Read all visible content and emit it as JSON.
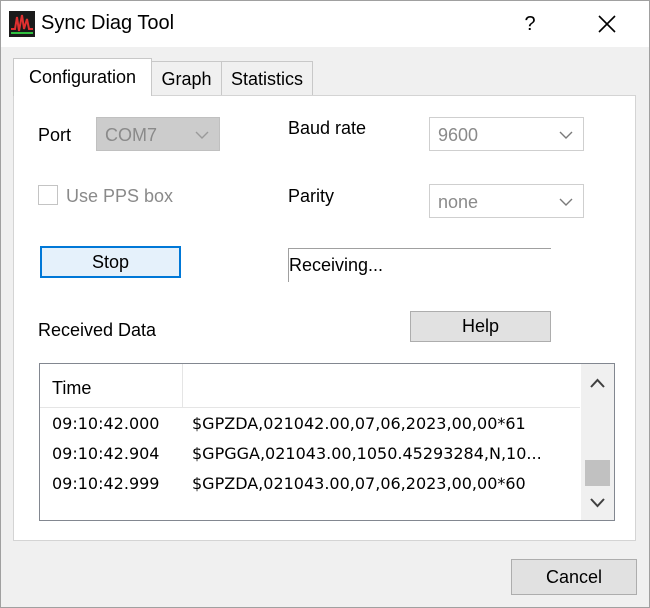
{
  "window": {
    "title": "Sync Diag Tool",
    "help_glyph": "?"
  },
  "tabs": [
    {
      "label": "Configuration",
      "active": true
    },
    {
      "label": "Graph",
      "active": false
    },
    {
      "label": "Statistics",
      "active": false
    }
  ],
  "config": {
    "port_label": "Port",
    "port_value": "COM7",
    "baud_label": "Baud rate",
    "baud_value": "9600",
    "pps_label": "Use PPS box",
    "parity_label": "Parity",
    "parity_value": "none",
    "stop_label": "Stop",
    "status_text": "Receiving...",
    "received_label": "Received Data",
    "help_label": "Help"
  },
  "list": {
    "columns": [
      "Time",
      ""
    ],
    "rows": [
      {
        "time": "09:10:42.000",
        "data": "$GPZDA,021042.00,07,06,2023,00,00*61"
      },
      {
        "time": "09:10:42.904",
        "data": "$GPGGA,021043.00,1050.45293284,N,10..."
      },
      {
        "time": "09:10:42.999",
        "data": "$GPZDA,021043.00,07,06,2023,00,00*60"
      }
    ]
  },
  "footer": {
    "cancel_label": "Cancel"
  },
  "colors": {
    "accent": "#0078d7",
    "focus_fill": "#e5f1fb",
    "disabled_text": "#8a8a8a"
  }
}
